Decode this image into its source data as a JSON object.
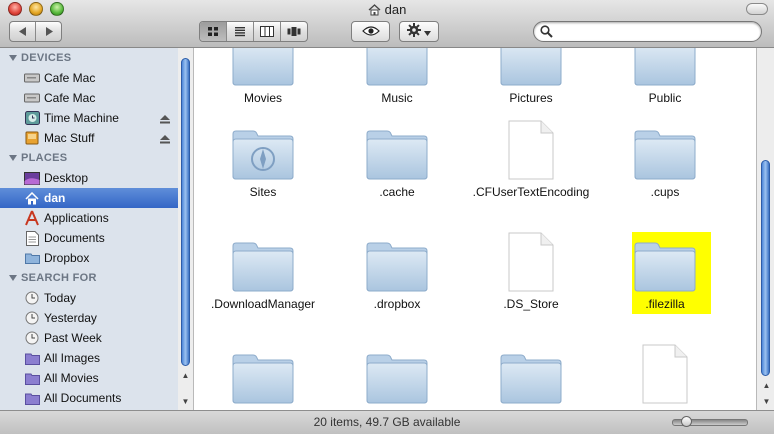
{
  "window": {
    "title": "dan"
  },
  "toolbar": {
    "view_buttons": [
      "icon-view-icon",
      "list-view-icon",
      "column-view-icon",
      "coverflow-view-icon"
    ],
    "active_view": "icon",
    "quicklook_icon": "eye-icon",
    "action_icon": "gear-icon",
    "search": {
      "value": "",
      "placeholder": ""
    }
  },
  "sidebar": {
    "sections": [
      {
        "title": "DEVICES",
        "items": [
          {
            "label": "Cafe Mac",
            "icon": "hard-drive-icon"
          },
          {
            "label": "Cafe Mac",
            "icon": "hard-drive-icon"
          },
          {
            "label": "Time Machine",
            "icon": "time-machine-icon",
            "eject": true
          },
          {
            "label": "Mac Stuff",
            "icon": "external-drive-icon",
            "eject": true
          }
        ]
      },
      {
        "title": "PLACES",
        "items": [
          {
            "label": "Desktop",
            "icon": "desktop-icon"
          },
          {
            "label": "dan",
            "icon": "home-icon",
            "selected": true
          },
          {
            "label": "Applications",
            "icon": "applications-icon"
          },
          {
            "label": "Documents",
            "icon": "documents-icon"
          },
          {
            "label": "Dropbox",
            "icon": "dropbox-icon"
          }
        ]
      },
      {
        "title": "SEARCH FOR",
        "items": [
          {
            "label": "Today",
            "icon": "clock-icon"
          },
          {
            "label": "Yesterday",
            "icon": "clock-icon"
          },
          {
            "label": "Past Week",
            "icon": "clock-icon"
          },
          {
            "label": "All Images",
            "icon": "smart-folder-icon"
          },
          {
            "label": "All Movies",
            "icon": "smart-folder-icon"
          },
          {
            "label": "All Documents",
            "icon": "smart-folder-icon"
          }
        ]
      }
    ]
  },
  "files": [
    {
      "name": "Movies",
      "kind": "folder"
    },
    {
      "name": "Music",
      "kind": "folder"
    },
    {
      "name": "Pictures",
      "kind": "folder"
    },
    {
      "name": "Public",
      "kind": "folder"
    },
    {
      "name": "Sites",
      "kind": "sites-folder"
    },
    {
      "name": ".cache",
      "kind": "folder"
    },
    {
      "name": ".CFUserTextEncoding",
      "kind": "document"
    },
    {
      "name": ".cups",
      "kind": "folder"
    },
    {
      "name": ".DownloadManager",
      "kind": "folder"
    },
    {
      "name": ".dropbox",
      "kind": "folder"
    },
    {
      "name": ".DS_Store",
      "kind": "document"
    },
    {
      "name": ".filezilla",
      "kind": "folder",
      "highlighted": true
    },
    {
      "name": "",
      "kind": "folder"
    },
    {
      "name": "",
      "kind": "folder"
    },
    {
      "name": "",
      "kind": "folder"
    },
    {
      "name": "",
      "kind": "document"
    }
  ],
  "status": {
    "text": "20 items, 49.7 GB available"
  },
  "colors": {
    "highlight": "#ffff00",
    "selection": "#3466c6",
    "sidebar_bg": "#dce3ec"
  }
}
